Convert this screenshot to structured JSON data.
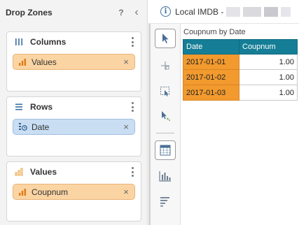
{
  "drop_zones": {
    "title": "Drop Zones",
    "help_label": "?",
    "collapse_label": "‹",
    "zones": [
      {
        "title": "Columns",
        "icon": "columns-icon",
        "chip": {
          "label": "Values",
          "icon": "measure-bars-icon",
          "kind": "measure"
        }
      },
      {
        "title": "Rows",
        "icon": "rows-icon",
        "chip": {
          "label": "Date",
          "icon": "date-hierarchy-icon",
          "kind": "dimension"
        }
      },
      {
        "title": "Values",
        "icon": "values-bars-icon",
        "chip": {
          "label": "Coupnum",
          "icon": "measure-bars-icon",
          "kind": "measure"
        }
      }
    ],
    "chip_close": "×"
  },
  "topbar": {
    "info_icon": "i",
    "datasource": "Local IMDB -"
  },
  "toolstrip": {
    "tools": [
      "select-arrow-icon",
      "crosshair-icon",
      "marquee-select-icon",
      "drill-arrow-icon",
      "table-view-icon",
      "bar-chart-icon",
      "sort-lines-icon"
    ],
    "active": "select-arrow-icon"
  },
  "table": {
    "title": "Coupnum by Date",
    "headers": [
      "Date",
      "Coupnum"
    ],
    "rows": [
      {
        "date": "2017-01-01",
        "value": "1.00"
      },
      {
        "date": "2017-01-02",
        "value": "1.00"
      },
      {
        "date": "2017-01-03",
        "value": "1.00"
      }
    ]
  },
  "colors": {
    "measure_chip": "#fbd4a3",
    "dimension_chip": "#c9def3",
    "header_teal": "#157e96",
    "row_header_orange": "#f29a2e"
  }
}
